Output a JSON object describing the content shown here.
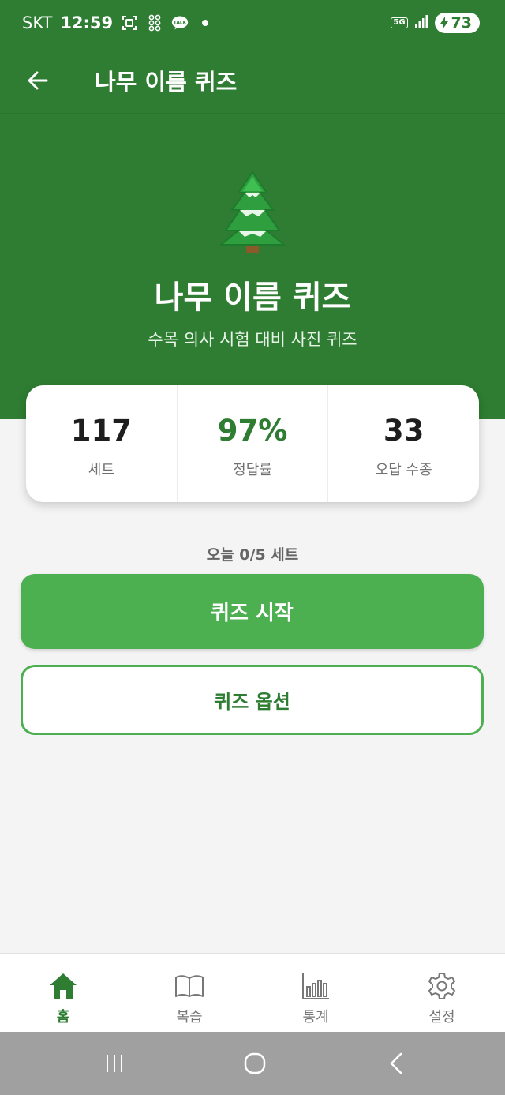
{
  "status_bar": {
    "carrier": "SKT",
    "time": "12:59",
    "network": "5G",
    "battery": "73",
    "icons": [
      "screenshot-icon",
      "dots-grid-icon",
      "kakaotalk-icon",
      "notification-dot-icon",
      "signal-icon",
      "battery-charging-icon"
    ]
  },
  "app_bar": {
    "title": "나무 이름 퀴즈",
    "back_icon": "arrow-left-icon"
  },
  "hero": {
    "emoji": "🌲",
    "title": "나무 이름 퀴즈",
    "subtitle": "수목 의사 시험 대비 사진 퀴즈"
  },
  "stats": [
    {
      "value": "117",
      "label": "세트"
    },
    {
      "value": "97%",
      "label": "정답률"
    },
    {
      "value": "33",
      "label": "오답 수종"
    }
  ],
  "today": "오늘 0/5 세트",
  "buttons": {
    "start": "퀴즈 시작",
    "options": "퀴즈 옵션"
  },
  "bottom_nav": [
    {
      "label": "홈",
      "icon": "home-icon",
      "active": true
    },
    {
      "label": "복습",
      "icon": "book-icon",
      "active": false
    },
    {
      "label": "통계",
      "icon": "bar-chart-icon",
      "active": false
    },
    {
      "label": "설정",
      "icon": "gear-icon",
      "active": false
    }
  ],
  "colors": {
    "primary": "#2e7d32",
    "accent": "#4caf50",
    "background": "#f4f4f4"
  }
}
